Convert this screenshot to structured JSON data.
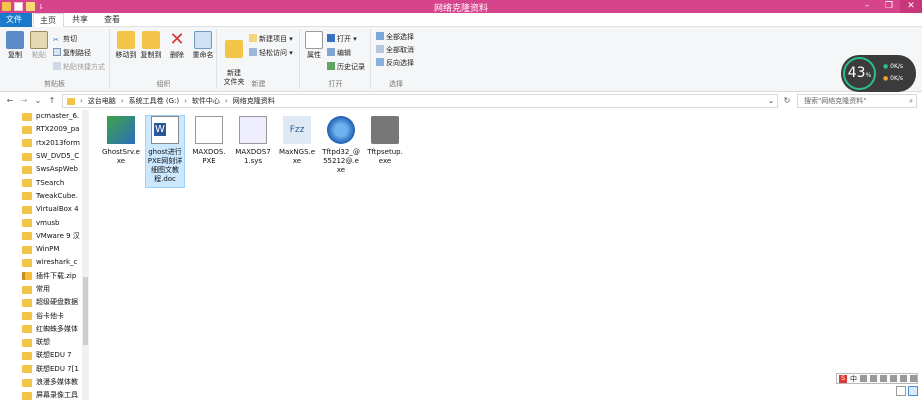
{
  "window": {
    "title": "网络克隆资料"
  },
  "titlebar": {
    "min": "–",
    "max": "❐",
    "close": "✕",
    "qa_drop": "⇂"
  },
  "tabs": {
    "file": "文件",
    "home": "主页",
    "share": "共享",
    "view": "查看"
  },
  "ribbon": {
    "clipboard": {
      "label": "剪贴板",
      "pin": "固定到\"快速访问\"",
      "copy": "复制",
      "paste": "粘贴",
      "cut": "剪切",
      "copy_path": "复制路径",
      "paste_shortcut": "粘贴快捷方式"
    },
    "organize": {
      "label": "组织",
      "move_to": "移动到",
      "copy_to": "复制到",
      "delete": "删除",
      "rename": "重命名"
    },
    "new": {
      "label": "新建",
      "new_folder": "新建\n文件夹",
      "new_item": "新建项目 ▾",
      "easy_access": "轻松访问 ▾"
    },
    "open": {
      "label": "打开",
      "properties": "属性",
      "open": "打开 ▾",
      "edit": "编辑",
      "history": "历史记录"
    },
    "select": {
      "label": "选择",
      "select_all": "全部选择",
      "select_none": "全部取消",
      "invert": "反向选择"
    }
  },
  "address": {
    "back": "←",
    "forward": "→",
    "dropdown": "⌄",
    "up": "↑",
    "path": [
      "这台电脑",
      "系统工具卷 (G:)",
      "软件中心",
      "网络克隆资料"
    ],
    "sep": "›",
    "search_placeholder": "搜索\"网络克隆资料\"",
    "search_icon": "⌕",
    "refresh": "↻",
    "path_dropdown": "⌄"
  },
  "nav_items": [
    "pcmaster_6.",
    "RTX2009_pa",
    "rtx2013form",
    "SW_DVD5_C",
    "SwsAspWeb",
    "TSearch",
    "TweakCube.",
    "VirtualBox 4",
    "vmusb",
    "VMware 9 汉",
    "WinPM",
    "wireshark_c",
    "插件下载.zip",
    "常用",
    "超级硬盘数据",
    "俗卡他卡",
    "红蜘蛛多媒体",
    "联想",
    "联想EDU 7",
    "联想EDU 7[1",
    "浪漫多媒体教",
    "屏幕录像工具"
  ],
  "files": [
    {
      "name": "GhostSrv.e\nxe",
      "icon": "ghost-exe"
    },
    {
      "name": "ghost进行\nPXE网刻详\n细图文教\n程.doc",
      "icon": "word-doc"
    },
    {
      "name": "MAXDOS.\nPXE",
      "icon": "blank-file"
    },
    {
      "name": "MAXDOS7\n1.sys",
      "icon": "sys-file"
    },
    {
      "name": "MaxNGS.e\nxe",
      "icon": "fzz-exe"
    },
    {
      "name": "Tftpd32_@\n55212@.e\nxe",
      "icon": "tftpd-exe"
    },
    {
      "name": "Tftpsetup.\nexe",
      "icon": "tftpsetup-exe"
    }
  ],
  "widget": {
    "percent": "43",
    "unit": "%",
    "up": "0K/s",
    "down": "0K/s"
  },
  "ime": {
    "lang": "中"
  },
  "colors": {
    "title_bar": "#d6448c",
    "file_tab": "#1979ca",
    "folder": "#f2c447",
    "selection": "#cce8ff"
  }
}
